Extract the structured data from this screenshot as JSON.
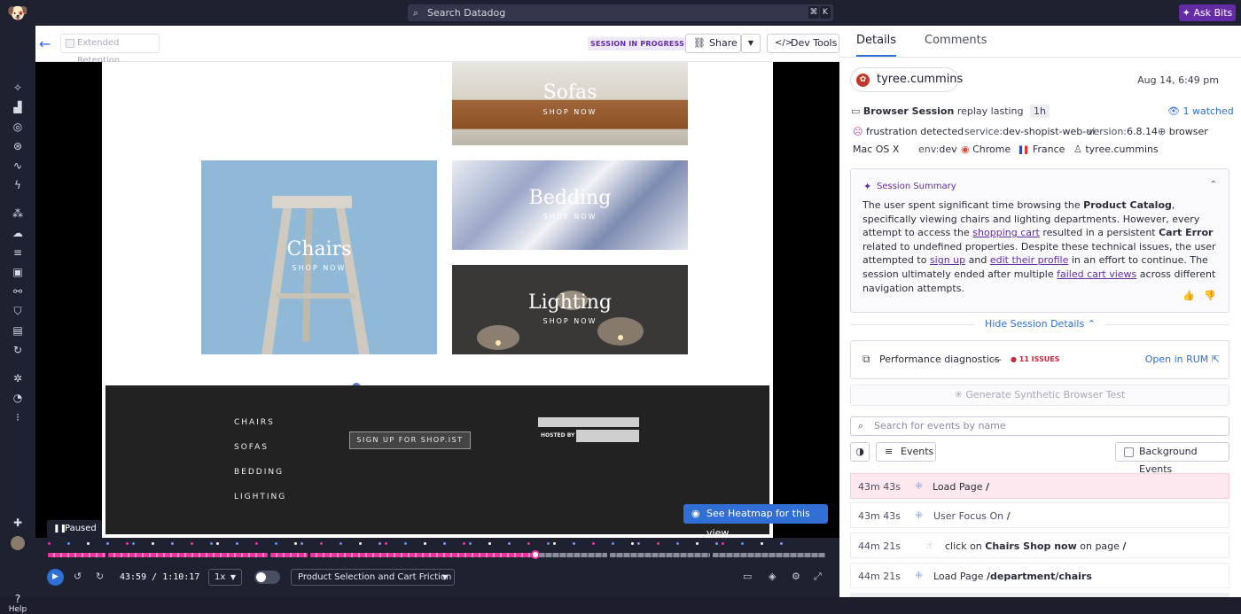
{
  "topbar": {
    "search_placeholder": "Search Datadog",
    "kbd_cmd": "⌘",
    "kbd_k": "K",
    "ask_bits": "Ask Bits"
  },
  "nav": {
    "help": "Help"
  },
  "toolbar": {
    "extended_retention": "Extended Retention",
    "session_status": "SESSION IN PROGRESS",
    "share": "Share",
    "dev_tools": "Dev Tools"
  },
  "replay": {
    "tiles": [
      {
        "title": "Sofas",
        "sub": "SHOP NOW"
      },
      {
        "title": "Chairs",
        "sub": "SHOP NOW"
      },
      {
        "title": "Bedding",
        "sub": "SHOP NOW"
      },
      {
        "title": "Lighting",
        "sub": "SHOP NOW"
      }
    ],
    "footer_links": [
      "CHAIRS",
      "SOFAS",
      "BEDDING",
      "LIGHTING"
    ],
    "signup": "SIGN UP FOR SHOP.IST",
    "hosted_by": "HOSTED BY",
    "heatmap": "See Heatmap for this view"
  },
  "player": {
    "state": "Paused",
    "current_time": "43:59",
    "separator": "/",
    "total_time": "1:10:17",
    "speed": "1x",
    "context": "Product Selection and Cart Friction",
    "progress": 0.62
  },
  "details": {
    "tabs": [
      "Details",
      "Comments"
    ],
    "user": "tyree.cummins",
    "date": "Aug 14, 6:49 pm",
    "session_type": "Browser Session",
    "replay_lasting": "replay lasting",
    "duration": "1h",
    "watched": "1 watched",
    "frustration": "frustration detected",
    "service_key": "service:",
    "service_val": "dev-shopist-web-ui",
    "version_key": "version:",
    "version_val": "6.8.14",
    "browser_tag": "browser",
    "os": "Mac OS X",
    "env_key": "env:",
    "env_val": "dev",
    "browser": "Chrome",
    "country": "France",
    "user_tag": "tyree.cummins",
    "summary_title": "Session Summary",
    "summary": {
      "p1": "The user spent significant time browsing the ",
      "b1": "Product Catalog",
      "p2": ", specifically viewing chairs and lighting departments. However, every attempt to access the ",
      "l1": "shopping cart",
      "p3": " resulted in a persistent ",
      "b2": "Cart Error",
      "p4": " related to undefined properties. Despite these technical issues, the user attempted to ",
      "l2": "sign up",
      "p5": " and ",
      "l3": "edit their profile",
      "p6": " in an effort to continue. The session ultimately ended after multiple ",
      "l4": "failed cart views",
      "p7": " across different navigation attempts."
    },
    "hide_details": "Hide Session Details",
    "perf_label": "Performance diagnostics",
    "perf_dash": "—",
    "issues": "11 ISSUES",
    "open_rum": "Open in RUM",
    "generate_test": "Generate Synthetic Browser Test",
    "search_events": "Search for events by name",
    "events_btn": "Events",
    "background_events": "Background Events"
  },
  "events": [
    {
      "time": "43m 43s",
      "pre": "Load Page ",
      "bold": "/",
      "post": "",
      "page": ""
    },
    {
      "time": "43m 43s",
      "pre": "User Focus On ",
      "bold": "/",
      "post": "",
      "page": ""
    },
    {
      "time": "44m 21s",
      "pre": "click on ",
      "bold": "Chairs Shop now",
      "post": " on page ",
      "page": "/"
    },
    {
      "time": "44m 21s",
      "pre": "Load Page ",
      "bold": "/department/chairs",
      "post": "",
      "page": ""
    }
  ],
  "colors": {
    "accent": "#632ca6",
    "link": "#2f6fd6",
    "timeline": "#e7359f",
    "highlight": "#fde8ef"
  }
}
